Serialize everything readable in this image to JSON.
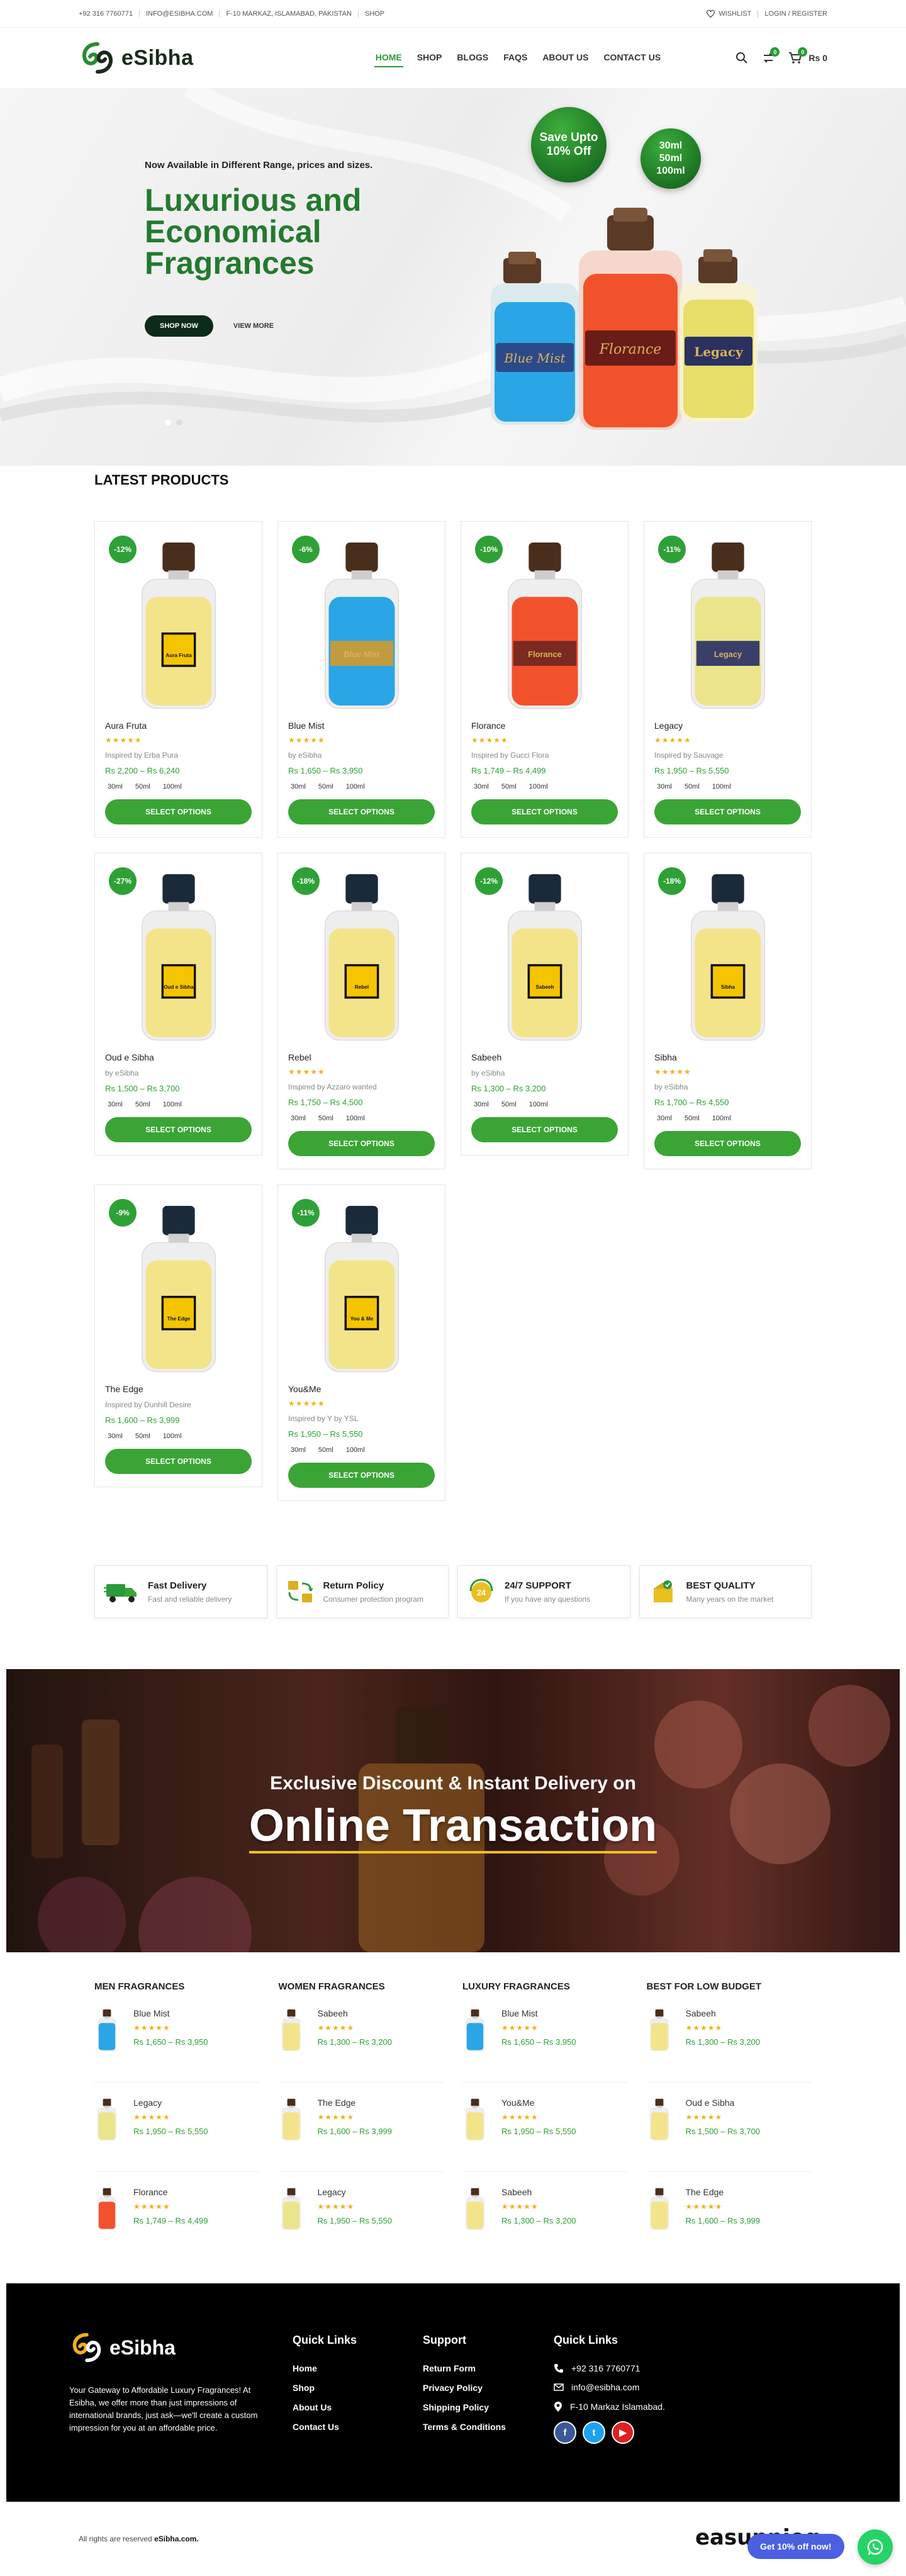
{
  "topbar": {
    "phone": "+92 316 7760771",
    "email": "INFO@ESIBHA.COM",
    "address": "F-10 MARKAZ, ISLAMABAD, PAKISTAN",
    "shop": "SHOP",
    "wishlist": "WISHLIST",
    "login": "LOGIN / REGISTER"
  },
  "header": {
    "logo_text": "eSibha",
    "nav": [
      "HOME",
      "SHOP",
      "BLOGS",
      "FAQS",
      "ABOUT US",
      "CONTACT US"
    ],
    "compare_count": "0",
    "cart_count": "0",
    "cart_total": "Rs 0"
  },
  "hero": {
    "subtitle": "Now Available in Different Range, prices and sizes.",
    "title": "Luxurious and Economical Fragrances",
    "shop_now": "SHOP NOW",
    "view_more": "VIEW MORE",
    "promo1_line1": "Save Upto",
    "promo1_line2": "10% Off",
    "promo2_line1": "30ml",
    "promo2_line2": "50ml",
    "promo2_line3": "100ml",
    "bottle_labels": [
      "Blue Mist",
      "Florance",
      "Legacy"
    ]
  },
  "latest": {
    "title": "LATEST PRODUCTS",
    "select_label": "SELECT OPTIONS",
    "sizes": [
      "30ml",
      "50ml",
      "100ml"
    ],
    "stars": "★★★★★",
    "products": [
      {
        "discount": "-12%",
        "name": "Aura Fruta",
        "stars": true,
        "inspired": "Inspired by Erba Pura",
        "price": "Rs 2,200 – Rs 6,240",
        "label": "Aura Fruta",
        "liquid": "#f3e48a",
        "cap": "#4a2e1c",
        "labelbg": "#f5c400"
      },
      {
        "discount": "-6%",
        "name": "Blue Mist",
        "stars": true,
        "inspired": "by eSibha",
        "price": "Rs 1,650 – Rs 3,950",
        "label": "Blue Mist",
        "liquid": "#2aa6e6",
        "cap": "#4a2e1c",
        "labelbg": "#c29b40"
      },
      {
        "discount": "-10%",
        "name": "Florance",
        "stars": true,
        "inspired": "Inspired by Gucci Flora",
        "price": "Rs 1,749 – Rs 4,499",
        "label": "Florance",
        "liquid": "#f2522b",
        "cap": "#4a2e1c",
        "labelbg": "#7a2a20"
      },
      {
        "discount": "-11%",
        "name": "Legacy",
        "stars": true,
        "inspired": "Inspired by Sauvage",
        "price": "Rs 1,950 – Rs 5,550",
        "label": "Legacy",
        "liquid": "#ece48a",
        "cap": "#4a2e1c",
        "labelbg": "#3a3f6a"
      },
      {
        "discount": "-27%",
        "name": "Oud e Sibha",
        "stars": false,
        "inspired": "by eSibha",
        "price": "Rs 1,500 – Rs 3,700",
        "label": "Oud e Sibha",
        "liquid": "#f3e48a",
        "cap": "#1a2a3a",
        "labelbg": "#f5c400"
      },
      {
        "discount": "-18%",
        "name": "Rebel",
        "stars": true,
        "inspired": "Inspired by Azzaro wanted",
        "price": "Rs 1,750 – Rs 4,500",
        "label": "Rebel",
        "liquid": "#f3e48a",
        "cap": "#1a2a3a",
        "labelbg": "#f5c400"
      },
      {
        "discount": "-12%",
        "name": "Sabeeh",
        "stars": false,
        "inspired": "by eSibha",
        "price": "Rs 1,300 – Rs 3,200",
        "label": "Sabeeh",
        "liquid": "#f3e48a",
        "cap": "#1a2a3a",
        "labelbg": "#f5c400"
      },
      {
        "discount": "-18%",
        "name": "Sibha",
        "stars": true,
        "inspired": "by eSibha",
        "price": "Rs 1,700 – Rs 4,550",
        "label": "Sibha",
        "liquid": "#f3e48a",
        "cap": "#1a2a3a",
        "labelbg": "#f5c400"
      },
      {
        "discount": "-9%",
        "name": "The Edge",
        "stars": false,
        "inspired": "Inspired by Dunhill Desire",
        "price": "Rs 1,600 – Rs 3,999",
        "label": "The Edge",
        "liquid": "#f3e48a",
        "cap": "#1a2a3a",
        "labelbg": "#f5c400"
      },
      {
        "discount": "-11%",
        "name": "You&Me",
        "stars": true,
        "inspired": "Inspired by Y by YSL",
        "price": "Rs 1,950 – Rs 5,550",
        "label": "You & Me",
        "liquid": "#f3e48a",
        "cap": "#1a2a3a",
        "labelbg": "#f5c400"
      }
    ]
  },
  "features": [
    {
      "title": "Fast Delivery",
      "sub": "Fast and reliable delivery",
      "icon": "truck-icon"
    },
    {
      "title": "Return Policy",
      "sub": "Consumer protection program",
      "icon": "return-icon"
    },
    {
      "title": "24/7 SUPPORT",
      "sub": "If you have any questions",
      "icon": "support-icon"
    },
    {
      "title": "BEST QUALITY",
      "sub": "Many years on the market",
      "icon": "quality-icon"
    }
  ],
  "banner": {
    "sub": "Exclusive Discount & Instant Delivery on",
    "main": "Online Transaction"
  },
  "lists": [
    {
      "title": "MEN FRAGRANCES",
      "items": [
        {
          "name": "Blue Mist",
          "price": "Rs 1,650 – Rs 3,950",
          "liquid": "#2aa6e6"
        },
        {
          "name": "Legacy",
          "price": "Rs 1,950 – Rs 5,550",
          "liquid": "#ece48a"
        },
        {
          "name": "Florance",
          "price": "Rs 1,749 – Rs 4,499",
          "liquid": "#f2522b"
        }
      ]
    },
    {
      "title": "WOMEN FRAGRANCES",
      "items": [
        {
          "name": "Sabeeh",
          "price": "Rs 1,300 – Rs 3,200",
          "liquid": "#f3e48a"
        },
        {
          "name": "The Edge",
          "price": "Rs 1,600 – Rs 3,999",
          "liquid": "#f3e48a"
        },
        {
          "name": "Legacy",
          "price": "Rs 1,950 – Rs 5,550",
          "liquid": "#ece48a"
        }
      ]
    },
    {
      "title": "LUXURY FRAGRANCES",
      "items": [
        {
          "name": "Blue Mist",
          "price": "Rs 1,650 – Rs 3,950",
          "liquid": "#2aa6e6"
        },
        {
          "name": "You&Me",
          "price": "Rs 1,950 – Rs 5,550",
          "liquid": "#f3e48a"
        },
        {
          "name": "Sabeeh",
          "price": "Rs 1,300 – Rs 3,200",
          "liquid": "#f3e48a"
        }
      ]
    },
    {
      "title": "BEST FOR LOW BUDGET",
      "items": [
        {
          "name": "Sabeeh",
          "price": "Rs 1,300 – Rs 3,200",
          "liquid": "#f3e48a"
        },
        {
          "name": "Oud e Sibha",
          "price": "Rs 1,500 – Rs 3,700",
          "liquid": "#f3e48a"
        },
        {
          "name": "The Edge",
          "price": "Rs 1,600 – Rs 3,999",
          "liquid": "#f3e48a"
        }
      ]
    }
  ],
  "footer": {
    "logo_text": "eSibha",
    "about": "Your Gateway to Affordable Luxury Fragrances! At Esibha, we offer more than just impressions of international brands, just ask—we'll create a custom impression for you at an affordable price.",
    "quick_title": "Quick Links",
    "quick": [
      "Home",
      "Shop",
      "About Us",
      "Contact Us"
    ],
    "support_title": "Support",
    "support": [
      "Return Form",
      "Privacy Policy",
      "Shipping Policy",
      "Terms & Conditions"
    ],
    "contact_title": "Quick Links",
    "phone": "+92 316 7760771",
    "email": "info@esibha.com",
    "address": "F-10 Markaz Islamabad."
  },
  "bottom": {
    "rights_prefix": "All rights are reserved",
    "rights_brand": "eSibha.com.",
    "easy_logo": "easupniog",
    "chat_label": "Get 10% off now!"
  },
  "colors": {
    "brand_green": "#2a9a3a",
    "dark_green": "#0d2b1a",
    "price_green": "#2ea136",
    "star": "#f2b01e"
  }
}
